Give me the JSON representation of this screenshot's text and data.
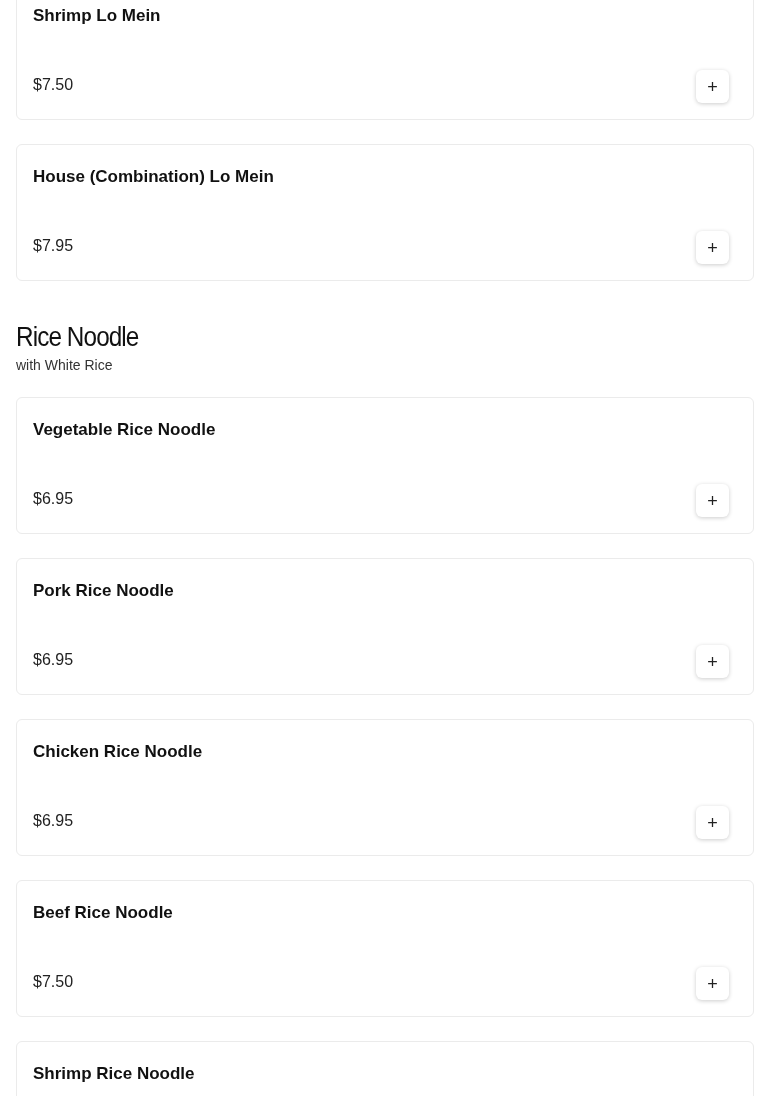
{
  "sections": [
    {
      "items": [
        {
          "name": "Shrimp Lo Mein",
          "price": "$7.50",
          "add": "+"
        },
        {
          "name": "House (Combination) Lo Mein",
          "price": "$7.95",
          "add": "+"
        }
      ]
    },
    {
      "title": "Rice Noodle",
      "subtitle": "with White Rice",
      "items": [
        {
          "name": "Vegetable Rice Noodle",
          "price": "$6.95",
          "add": "+"
        },
        {
          "name": "Pork Rice Noodle",
          "price": "$6.95",
          "add": "+"
        },
        {
          "name": "Chicken Rice Noodle",
          "price": "$6.95",
          "add": "+"
        },
        {
          "name": "Beef Rice Noodle",
          "price": "$7.50",
          "add": "+"
        },
        {
          "name": "Shrimp Rice Noodle"
        }
      ]
    }
  ]
}
